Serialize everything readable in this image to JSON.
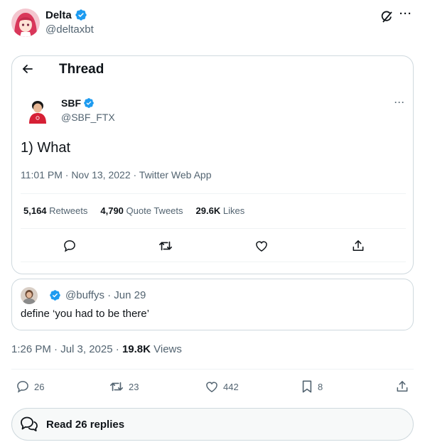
{
  "post": {
    "author_name": "Delta",
    "author_handle": "@deltaxbt",
    "timestamp": "1:26 PM · Jul 3, 2025",
    "views_count": "19.8K",
    "views_label": "Views",
    "actions": {
      "replies": "26",
      "reposts": "23",
      "likes": "442",
      "bookmarks": "8"
    },
    "read_replies_label": "Read 26 replies"
  },
  "screenshot": {
    "header_title": "Thread",
    "author_name": "SBF",
    "author_handle": "@SBF_FTX",
    "text": "1) What",
    "meta": "11:01 PM · Nov 13, 2022 · Twitter Web App",
    "stats": [
      {
        "count": "5,164",
        "label": "Retweets"
      },
      {
        "count": "4,790",
        "label": "Quote Tweets"
      },
      {
        "count": "29.6K",
        "label": "Likes"
      }
    ]
  },
  "quote": {
    "header": "@buffys · Jun 29",
    "text": "define ‘you had to be there’"
  },
  "colors": {
    "verified": "#1d9bf0",
    "border": "#cfd9de",
    "secondary_text": "#536471"
  },
  "icons": [
    "back-arrow-icon",
    "verified-badge-icon",
    "grok-icon",
    "more-icon",
    "reply-icon",
    "retweet-icon",
    "like-icon",
    "share-icon",
    "bookmark-icon",
    "chat-bubbles-icon"
  ]
}
